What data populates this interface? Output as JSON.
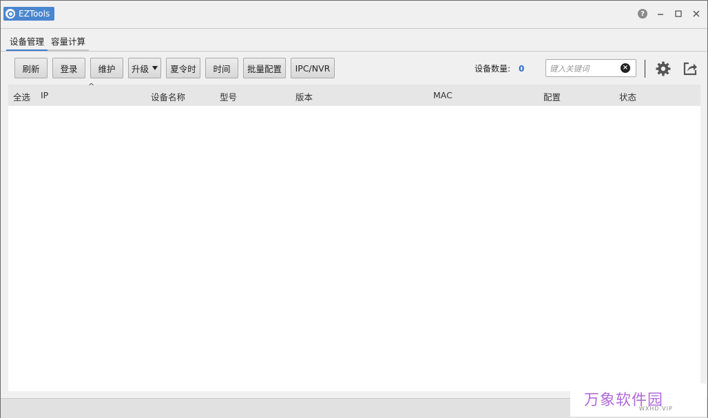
{
  "app": {
    "title": "EZTools"
  },
  "tabs": [
    {
      "label": "设备管理",
      "active": true
    },
    {
      "label": "容量计算",
      "active": false
    }
  ],
  "toolbar": {
    "buttons": [
      {
        "label": "刷新"
      },
      {
        "label": "登录"
      },
      {
        "label": "维护"
      },
      {
        "label": "升级"
      },
      {
        "label": "夏令时"
      },
      {
        "label": "时间"
      },
      {
        "label": "批量配置"
      },
      {
        "label": "IPC/NVR"
      }
    ],
    "device_count_label": "设备数量:",
    "device_count": "0",
    "search_placeholder": "键入关键词"
  },
  "table": {
    "columns": [
      {
        "label": "全选"
      },
      {
        "label": "IP"
      },
      {
        "label": "设备名称"
      },
      {
        "label": "型号"
      },
      {
        "label": "版本"
      },
      {
        "label": "MAC"
      },
      {
        "label": "配置"
      },
      {
        "label": "状态"
      }
    ],
    "sort_indicator": "^",
    "rows": []
  },
  "watermark": {
    "main": "万象软件园",
    "sub": "WXHD.VIP"
  },
  "colors": {
    "accent": "#3b7bd0",
    "badge": "#4a86cf",
    "count": "#2e6bd0"
  }
}
